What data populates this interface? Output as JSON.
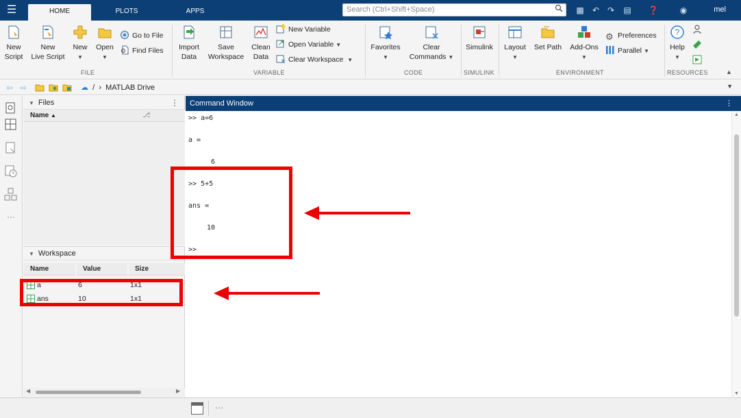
{
  "topbar": {
    "menu_icon": "hamburger-icon",
    "tabs": [
      {
        "label": "HOME",
        "active": true
      },
      {
        "label": "PLOTS",
        "active": false
      },
      {
        "label": "APPS",
        "active": false
      }
    ],
    "search_placeholder": "Search (Ctrl+Shift+Space)",
    "user": "mel"
  },
  "ribbon": {
    "file": {
      "section": "FILE",
      "new_script": [
        "New",
        "Script"
      ],
      "new_live_script": [
        "New",
        "Live Script"
      ],
      "new": "New",
      "open": "Open",
      "go_to_file": "Go to File",
      "find_files": "Find Files"
    },
    "variable": {
      "section": "VARIABLE",
      "import_data": [
        "Import",
        "Data"
      ],
      "save_workspace": [
        "Save",
        "Workspace"
      ],
      "clean_data": [
        "Clean",
        "Data"
      ],
      "new_variable": "New Variable",
      "open_variable": "Open Variable",
      "clear_workspace": "Clear Workspace"
    },
    "code": {
      "section": "CODE",
      "favorites": "Favorites",
      "clear_commands": [
        "Clear",
        "Commands"
      ]
    },
    "simulink": {
      "section": "SIMULINK",
      "simulink": "Simulink"
    },
    "environment": {
      "section": "ENVIRONMENT",
      "layout": "Layout",
      "set_path": "Set Path",
      "add_ons": "Add-Ons",
      "preferences": "Preferences",
      "parallel": "Parallel"
    },
    "resources": {
      "section": "RESOURCES",
      "help": "Help"
    }
  },
  "address": {
    "separator": "/",
    "chevron": "›",
    "location": "MATLAB Drive"
  },
  "files_panel": {
    "title": "Files",
    "col_name": "Name"
  },
  "workspace": {
    "title": "Workspace",
    "columns": [
      "Name",
      "Value",
      "Size"
    ],
    "rows": [
      {
        "name": "a",
        "value": "6",
        "size": "1x1"
      },
      {
        "name": "ans",
        "value": "10",
        "size": "1x1"
      }
    ]
  },
  "command_window": {
    "title": "Command Window",
    "lines": [
      ">> a=6",
      "a =",
      "6",
      ">> 5+5",
      "ans =",
      "10",
      ">>"
    ]
  },
  "colors": {
    "title_bar": "#0b3f76",
    "annotation": "#ee0000"
  }
}
